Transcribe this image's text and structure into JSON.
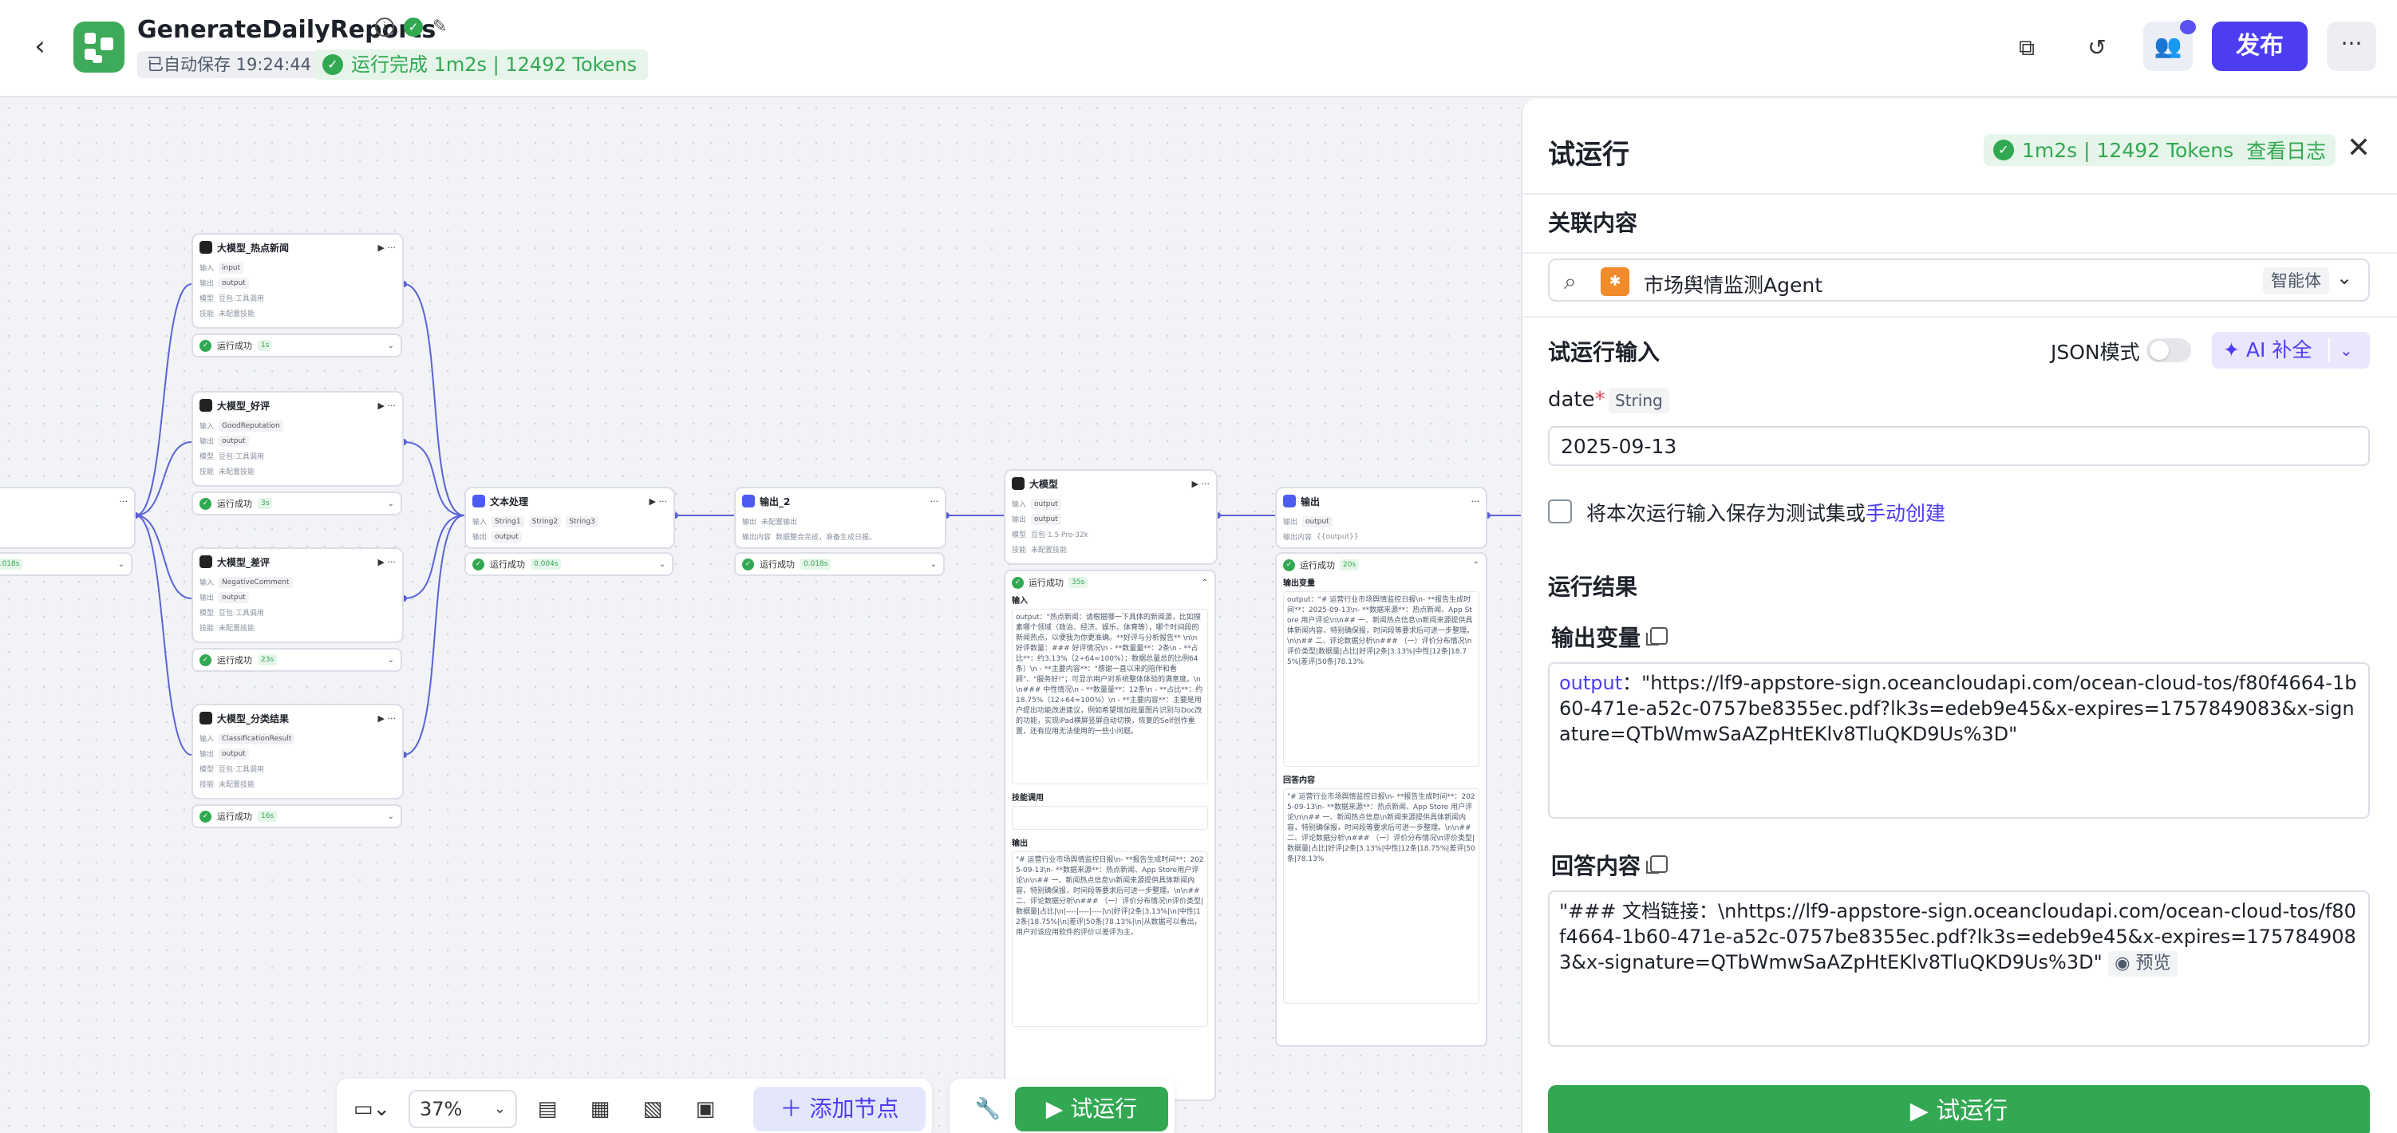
{
  "header": {
    "back_icon": "arrow-left-icon",
    "title": "GenerateDailyReports",
    "autosave": "已自动保存 19:24:44",
    "run_status": "运行完成 1m2s | 12492 Tokens",
    "publish_label": "发布",
    "more_label": "···"
  },
  "canvas": {
    "nodes": {
      "news": {
        "title": "大模型_热点新闻",
        "in_label": "输入",
        "in_var": "input",
        "out_label": "输出",
        "out_var": "output",
        "model_label": "模型",
        "model": "豆包·工具调用",
        "skill_label": "技能",
        "skill": "未配置技能",
        "run": "运行成功",
        "dur": "1s"
      },
      "good": {
        "title": "大模型_好评",
        "in_label": "输入",
        "in_var": "GoodReputation",
        "out_label": "输出",
        "out_var": "output",
        "model_label": "模型",
        "model": "豆包·工具调用",
        "skill_label": "技能",
        "skill": "未配置技能",
        "run": "运行成功",
        "dur": "3s"
      },
      "bad": {
        "title": "大模型_差评",
        "in_label": "输入",
        "in_var": "NegativeComment",
        "out_label": "输出",
        "out_var": "output",
        "model_label": "模型",
        "model": "豆包·工具调用",
        "skill_label": "技能",
        "skill": "未配置技能",
        "run": "运行成功",
        "dur": "23s"
      },
      "classify": {
        "title": "大模型_分类结果",
        "in_label": "输入",
        "in_var": "ClassificationResult",
        "out_label": "输出",
        "out_var": "output",
        "model_label": "模型",
        "model": "豆包·工具调用",
        "skill_label": "技能",
        "skill": "未配置技能",
        "run": "运行成功",
        "dur": "16s"
      },
      "text": {
        "title": "文本处理",
        "in_label": "输入",
        "in_vars": [
          "String1",
          "String2",
          "String3"
        ],
        "out_label": "输出",
        "out_var": "output",
        "run": "运行成功",
        "dur": "0.004s"
      },
      "output2": {
        "title": "输出_2",
        "in_label": "输出",
        "in_var": "未配置输出",
        "mode_label": "输出内容",
        "mode": "数据整合完成，准备生成日报。",
        "run": "运行成功",
        "dur": "0.018s"
      },
      "llm": {
        "title": "大模型",
        "in_label": "输入",
        "in_var": "output",
        "out_label": "输出",
        "out_var": "output",
        "model_label": "模型",
        "model": "豆包·1.5·Pro·32k",
        "skill_label": "技能",
        "skill": "未配置技能",
        "run": "运行成功",
        "dur": "35s",
        "panel_in": "输入",
        "panel_in_text": "output：\"热点新闻：请根据哪一下具体的新闻源，比如搜素哪个领域（政治、经济、娱乐、体育等），哪个时间段的新闻热点，以便我为你更准确。**好评与分析报告** \\n\\n好评数量：### 好评情况\\n - **数量量**：2条\\n - **占比**：约3.13%（2÷64≈100%）；数据总量总的比例64条）\\n - **主要内容**：\"感谢一直以来的陪伴和看顾\"、\"服务好!\"；可显示用户对系统整体体验的满意度。\\n\\n### 中性情况\\n - **数量量**：12条\\n - **占比**：约18.75%（12÷64≈100%）\\n - **主要内容**：主要是用户提出功能改进建议，例如希望增加批量图片识别与Doc改的功能，实现iPad横屏竖屏自动切换，恢复的Self创作重置，还有应用无法使用的一些小问题。",
        "panel_skill": "技能调用",
        "panel_out": "输出",
        "panel_out_text": "\"# 运营行业市场舆情监控日报\\n- **报告生成时间**：2025-09-13\\n- **数据来源**：热点新闻、App Store用户评论\\n\\n## 一、新闻热点信息\\n新闻来源提供具体新闻内容，特别确保报，时间段等要求后可进一步整理。\\n\\n## 二、评论数据分析\\n### （一）评价分布情况\\n评价类型|数据量|占比|\\n|----|----|----|\\n|好评|2条|3.13%|\\n|中性|12条|18.75%|\\n|差评|50条|78.13%|\\n|从数据可以看出，用户对该应用软件的评价以差评为主。"
      },
      "output": {
        "title": "输出",
        "in_label": "输出",
        "in_var": "output",
        "mode_label": "输出内容",
        "mode": "{{output}}",
        "run": "运行成功",
        "dur": "20s",
        "panel_in": "输出变量",
        "panel_in_text": "output：\"# 运营行业市场舆情监控日报\\n- **报告生成时间**：2025-09-13\\n- **数据来源**：热点新闻、App Store 用户评论\\n\\n## 一、新闻热点信息\\n新闻来源提供具体新闻内容，特别确保报，时间段等要求后可进一步整理。\\n\\n## 二、评论数据分析\\n### （一）评价分布情况\\n评价类型|数据量|占比|好评|2条|3.13%|中性|12条|18.75%|差评|50条|78.13%",
        "panel_out": "回答内容",
        "panel_out_text": "\"# 运营行业市场舆情监控日报\\n- **报告生成时间**：2025-09-13\\n- **数据来源**：热点新闻、App Store 用户评论\\n\\n## 一、新闻热点信息\\n新闻来源提供具体新闻内容，特别确保报，时间段等要求后可进一步整理。\\n\\n## 二、评论数据分析\\n### （一）评价分布情况\\n评价类型|数据量|占比|好评|2条|3.13%|中性|12条|18.75%|差评|50条|78.13%"
      },
      "start": {
        "dur": "0.018s"
      }
    }
  },
  "toolbar": {
    "zoom": "37%",
    "add_node": "＋ 添加节点",
    "run": "▶ 试运行"
  },
  "side": {
    "title": "试运行",
    "status": "1m2s | 12492 Tokens",
    "view_log": "查看日志",
    "related_label": "关联内容",
    "agent_name": "市场舆情监测Agent",
    "agent_tag": "智能体",
    "input_label": "试运行输入",
    "json_mode": "JSON模式",
    "ai_label": "AI 补全",
    "field_name": "date",
    "field_type": "String",
    "field_value": "2025-09-13",
    "save_text": "将本次运行输入保存为测试集或",
    "save_link": "手动创建",
    "result_label": "运行结果",
    "output_var_label": "输出变量",
    "output_key": "output",
    "output_value": "\"https://lf9-appstore-sign.oceancloudapi.com/ocean-cloud-tos/f80f4664-1b60-471e-a52c-0757be8355ec.pdf?lk3s=edeb9e45&x-expires=1757849083&x-signature=QTbWmwSaAZpHtEKlv8TluQKD9Us%3D\"",
    "answer_label": "回答内容",
    "answer_value": "\"### 文档链接：\\nhttps://lf9-appstore-sign.oceancloudapi.com/ocean-cloud-tos/f80f4664-1b60-471e-a52c-0757be8355ec.pdf?lk3s=edeb9e45&x-expires=1757849083&x-signature=QTbWmwSaAZpHtEKlv8TluQKD9Us%3D\"",
    "preview": "预览",
    "run_button": "▶ 试运行"
  },
  "colors": {
    "accent": "#4d3df2",
    "success": "#32a852",
    "edge": "#5b63d6"
  }
}
